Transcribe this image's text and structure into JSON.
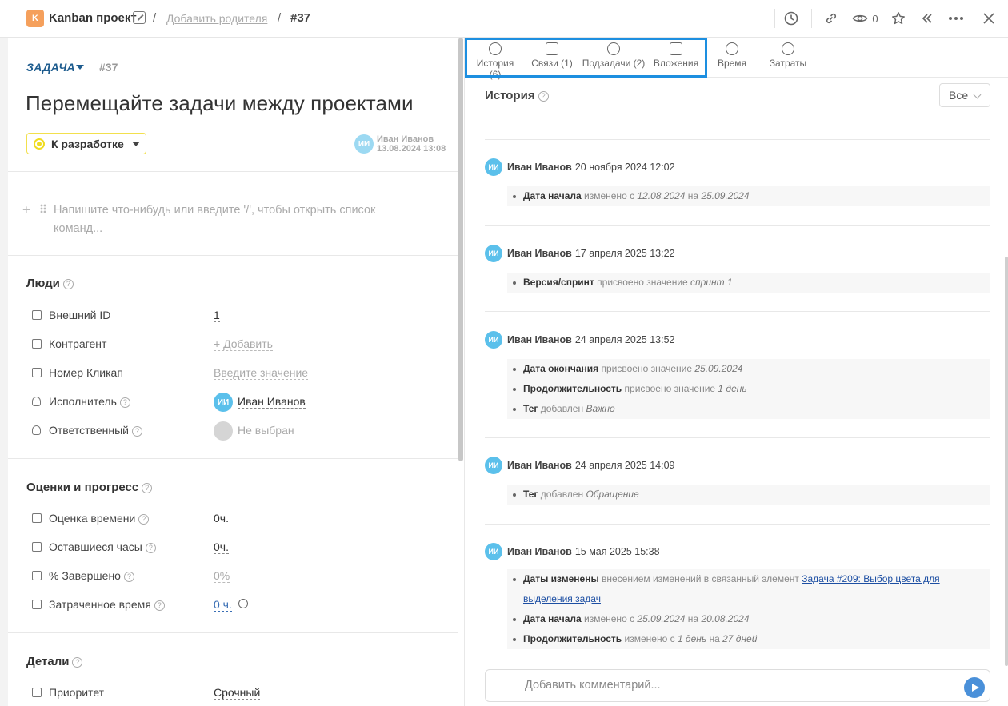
{
  "header": {
    "project_badge": "K",
    "project_name": "Kanban проект",
    "separator": "/",
    "add_parent": "Добавить родителя",
    "task_number": "#37",
    "watchers_count": "0",
    "icons": [
      "clock-icon",
      "link-icon",
      "eye-icon",
      "star-icon",
      "collapse-icon",
      "more-icon",
      "close-icon"
    ]
  },
  "task": {
    "type": "ЗАДАЧА",
    "number": "#37",
    "title": "Перемещайте задачи между проектами",
    "status": "К разработке",
    "status_color": "#f0dc1f",
    "author_initials": "ИИ",
    "author_name": "Иван Иванов",
    "author_date": "13.08.2024 13:08",
    "editor_placeholder": "Напишите что-нибудь или введите '/', чтобы открыть список команд..."
  },
  "people": {
    "title": "Люди",
    "external_id": {
      "label": "Внешний ID",
      "value": "1"
    },
    "counterparty": {
      "label": "Контрагент",
      "value": "+ Добавить"
    },
    "clickup": {
      "label": "Номер Кликап",
      "value": "Введите значение"
    },
    "assignee": {
      "label": "Исполнитель",
      "initials": "ИИ",
      "value": "Иван Иванов"
    },
    "responsible": {
      "label": "Ответственный",
      "value": "Не выбран"
    }
  },
  "estimates": {
    "title": "Оценки и прогресс",
    "time_estimate": {
      "label": "Оценка времени",
      "value": "0ч."
    },
    "remaining": {
      "label": "Оставшиеся часы",
      "value": "0ч."
    },
    "percent": {
      "label": "% Завершено",
      "value": "0%"
    },
    "spent": {
      "label": "Затраченное время",
      "value": "0 ч."
    }
  },
  "details": {
    "title": "Детали",
    "priority": {
      "label": "Приоритет",
      "value": "Срочный"
    }
  },
  "tabs": [
    {
      "label": "История (6)",
      "icon": "history-icon"
    },
    {
      "label": "Связи (1)",
      "icon": "relations-icon"
    },
    {
      "label": "Подзадачи (2)",
      "icon": "subtasks-icon"
    },
    {
      "label": "Вложения",
      "icon": "paperclip-icon"
    },
    {
      "label": "Время",
      "icon": "clock-icon"
    },
    {
      "label": "Затраты",
      "icon": "costs-icon"
    }
  ],
  "history": {
    "title": "История",
    "filter": "Все",
    "entries": [
      {
        "initials": "ИИ",
        "user": "Иван Иванов",
        "date": "20 ноября 2024 12:02",
        "changes": [
          {
            "field": "Дата начала",
            "pre": " изменено с ",
            "a": "12.08.2024",
            "mid": " на ",
            "b": "25.09.2024"
          }
        ]
      },
      {
        "initials": "ИИ",
        "user": "Иван Иванов",
        "date": "17 апреля 2025 13:22",
        "changes": [
          {
            "field": "Версия/спринт",
            "pre": " присвоено значение ",
            "a": "спринт 1"
          }
        ]
      },
      {
        "initials": "ИИ",
        "user": "Иван Иванов",
        "date": "24 апреля 2025 13:52",
        "changes": [
          {
            "field": "Дата окончания",
            "pre": " присвоено значение ",
            "a": "25.09.2024"
          },
          {
            "field": "Продолжительность",
            "pre": " присвоено значение ",
            "a": "1 день"
          },
          {
            "field": "Тег",
            "pre": " добавлен ",
            "a": "Важно"
          }
        ]
      },
      {
        "initials": "ИИ",
        "user": "Иван Иванов",
        "date": "24 апреля 2025 14:09",
        "changes": [
          {
            "field": "Тег",
            "pre": " добавлен ",
            "a": "Обращение"
          }
        ]
      },
      {
        "initials": "ИИ",
        "user": "Иван Иванов",
        "date": "15 мая 2025 15:38",
        "changes": [
          {
            "field": "Даты изменены",
            "pre": " внесением изменений в связанный элемент ",
            "link": "Задача #209: Выбор цвета для выделения задач"
          },
          {
            "field": "Дата начала",
            "pre": " изменено с ",
            "a": "25.09.2024",
            "mid": " на ",
            "b": "20.08.2024"
          },
          {
            "field": "Продолжительность",
            "pre": " изменено с ",
            "a": "1 день",
            "mid": " на ",
            "b": "27 дней"
          }
        ]
      }
    ]
  },
  "comment": {
    "placeholder": "Добавить комментарий..."
  }
}
